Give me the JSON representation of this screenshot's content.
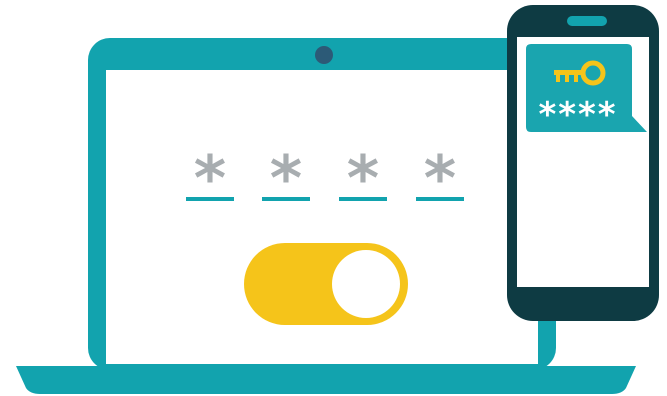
{
  "colors": {
    "teal": "#12A3AE",
    "teal_dark": "#0F8F99",
    "phone_body": "#0E3B43",
    "camera": "#2C5A77",
    "pin_char": "#A8ADB0",
    "pin_underline": "#12A3AE",
    "toggle_track": "#F5C41A",
    "toggle_knob": "#FFFFFF",
    "sms_bubble": "#1AA5AF",
    "sms_text": "#FFFFFF",
    "key_icon": "#F5C41A",
    "screen_bg": "#FFFFFF"
  },
  "laptop": {
    "pin_slots": [
      {
        "char": "*"
      },
      {
        "char": "*"
      },
      {
        "char": "*"
      },
      {
        "char": "*"
      }
    ],
    "toggle": {
      "state": "on"
    }
  },
  "phone": {
    "sms": {
      "icon": "key-icon",
      "code": "****"
    }
  }
}
